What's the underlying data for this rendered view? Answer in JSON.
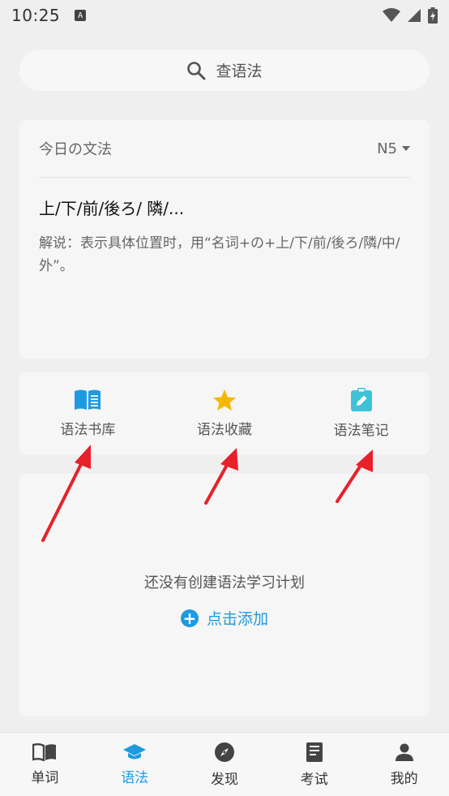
{
  "status": {
    "time": "10:25",
    "notification_icon": "a-icon"
  },
  "search": {
    "label": "查语法"
  },
  "today": {
    "title": "今日の文法",
    "level": "N5",
    "grammar_title": "上/下/前/後ろ/ 隣/...",
    "grammar_desc": "解说：表示具体位置时，用“名词+の+上/下/前/後ろ/隣/中/外”。"
  },
  "tools": [
    {
      "label": "语法书库",
      "icon": "book-icon"
    },
    {
      "label": "语法收藏",
      "icon": "star-icon"
    },
    {
      "label": "语法笔记",
      "icon": "clipboard-edit-icon"
    }
  ],
  "plan": {
    "empty_text": "还没有创建语法学习计划",
    "add_label": "点击添加"
  },
  "tabs": [
    {
      "label": "单词",
      "icon": "open-book-icon"
    },
    {
      "label": "语法",
      "icon": "graduation-cap-icon"
    },
    {
      "label": "发现",
      "icon": "compass-icon"
    },
    {
      "label": "考试",
      "icon": "exam-book-icon"
    },
    {
      "label": "我的",
      "icon": "person-icon"
    }
  ],
  "active_tab": "语法",
  "colors": {
    "accent": "#1e9ae0",
    "star": "#f5b800",
    "note": "#3ec2d8",
    "arrow": "#e8202a"
  }
}
